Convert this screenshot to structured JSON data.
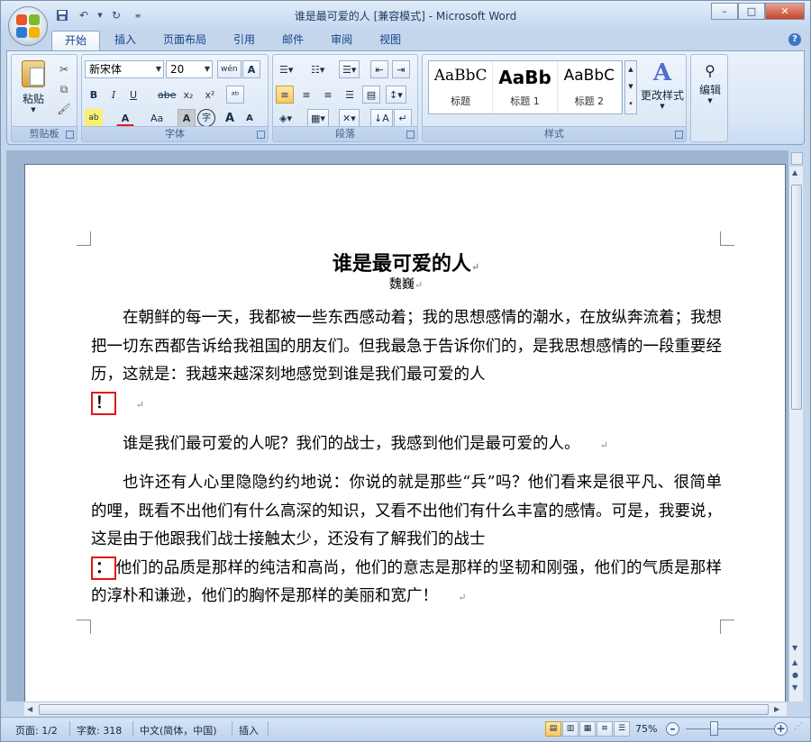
{
  "window": {
    "title": "谁是最可爱的人 [兼容模式] - Microsoft Word",
    "minimize": "–",
    "maximize": "□",
    "close": "✕"
  },
  "qat": {
    "save_icon": "save-icon",
    "undo_icon": "undo-icon",
    "redo_icon": "redo-icon"
  },
  "tabs": [
    {
      "label": "开始",
      "active": true
    },
    {
      "label": "插入"
    },
    {
      "label": "页面布局"
    },
    {
      "label": "引用"
    },
    {
      "label": "邮件"
    },
    {
      "label": "审阅"
    },
    {
      "label": "视图"
    }
  ],
  "ribbon": {
    "clipboard": {
      "label": "剪贴板",
      "paste_label": "粘贴"
    },
    "font": {
      "label": "字体",
      "font_name": "新宋体",
      "font_size": "20",
      "bold": "B",
      "italic": "I",
      "underline": "U",
      "strike": "abe",
      "subscript": "x₂",
      "superscript": "x²",
      "aa": "Aa",
      "grow": "A",
      "shrink": "A",
      "font_color": "A",
      "char_shade": "A",
      "encircle": "字",
      "wen": "wén",
      "boxed_a": "A"
    },
    "paragraph": {
      "label": "段落"
    },
    "styles": {
      "label": "样式",
      "items": [
        {
          "sample": "AaBbC",
          "name": "标题"
        },
        {
          "sample": "AaBb",
          "name": "标题 1"
        },
        {
          "sample": "AaBbC",
          "name": "标题 2"
        }
      ],
      "change_styles": "更改样式"
    },
    "editing": {
      "label": "编辑"
    }
  },
  "document": {
    "title": "谁是最可爱的人",
    "author": "魏巍",
    "p1": "在朝鲜的每一天，我都被一些东西感动着；我的思想感情的潮水，在放纵奔流着；我想把一切东西都告诉给我祖国的朋友们。但我最急于告诉你们的，是我思想感情的一段重要经历，这就是：我越来越深刻地感觉到谁是我们最可爱的人",
    "p1_mark": "！",
    "p2": "谁是我们最可爱的人呢？我们的战士，我感到他们是最可爱的人。",
    "p3a": "也许还有人心里隐隐约约地说：你说的就是那些“兵”吗？他们看来是很平凡、很简单的哩，既看不出他们有什么高深的知识，又看不出他们有什么丰富的感情。可是，我要说，这是由于他跟我们战士接触太少，还没有了解我们的战士",
    "p3_mark": "：",
    "p3b": "他们的品质是那样的纯洁和高尚，他们的意志是那样的坚韧和刚强，他们的气质是那样的淳朴和谦逊，他们的胸怀是那样的美丽和宽广！",
    "para_mark": "↵"
  },
  "status": {
    "page": "页面: 1/2",
    "words": "字数: 318",
    "language": "中文(简体，中国)",
    "mode": "插入",
    "zoom": "75%",
    "zoom_minus": "–",
    "zoom_plus": "+"
  }
}
